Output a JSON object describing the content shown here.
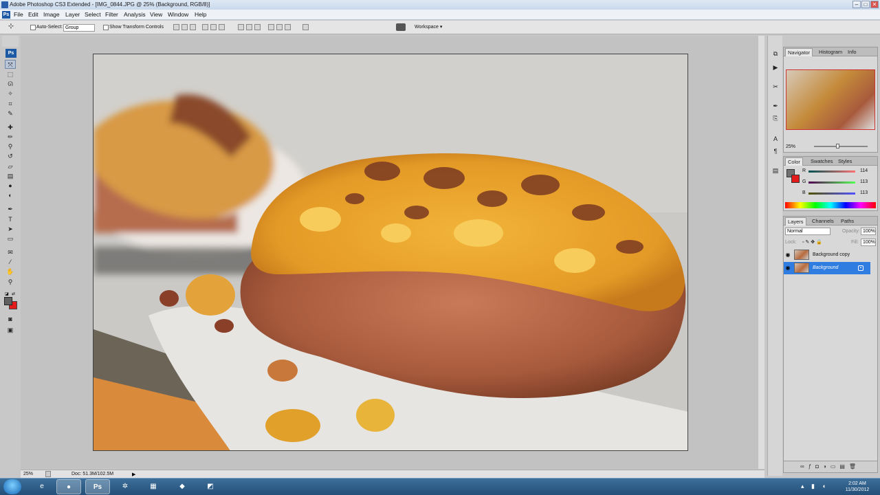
{
  "window": {
    "title": "Adobe Photoshop CS3 Extended - [IMG_0844.JPG @ 25% (Background, RGB/8)]",
    "controls": {
      "minimize": "–",
      "maximize": "□",
      "close": "✕"
    }
  },
  "menu": {
    "app_icon": "Ps",
    "items": [
      "File",
      "Edit",
      "Image",
      "Layer",
      "Select",
      "Filter",
      "Analysis",
      "View",
      "Window",
      "Help"
    ]
  },
  "options_bar": {
    "auto_select_label": "Auto-Select:",
    "auto_select_value": "Group",
    "transform_controls_label": "Show Transform Controls",
    "workspace_label": "Workspace ▾"
  },
  "tools": {
    "logo": "Ps",
    "icons": [
      "move-icon",
      "marquee-icon",
      "lasso-icon",
      "magic-wand-icon",
      "crop-icon",
      "slice-icon",
      "healing-brush-icon",
      "brush-icon",
      "clone-stamp-icon",
      "history-brush-icon",
      "eraser-icon",
      "gradient-icon",
      "blur-icon",
      "dodge-icon",
      "pen-icon",
      "type-icon",
      "path-selection-icon",
      "shape-icon",
      "notes-icon",
      "eyedropper-icon",
      "hand-icon",
      "zoom-icon"
    ],
    "foreground_color": "#606060",
    "background_color": "#e31b1b"
  },
  "status": {
    "zoom": "25%",
    "doc_size": "Doc: 51.3M/102.5M"
  },
  "navigator": {
    "tabs": [
      "Navigator",
      "Histogram",
      "Info"
    ],
    "zoom": "25%"
  },
  "color_panel": {
    "tabs": [
      "Color",
      "Swatches",
      "Styles"
    ],
    "channels": [
      {
        "label": "R",
        "value": "114"
      },
      {
        "label": "G",
        "value": "113"
      },
      {
        "label": "B",
        "value": "113"
      }
    ]
  },
  "layers_panel": {
    "tabs": [
      "Layers",
      "Channels",
      "Paths"
    ],
    "blend_mode": "Normal",
    "opacity_label": "Opacity:",
    "opacity_value": "100%",
    "lock_label": "Lock:",
    "fill_label": "Fill:",
    "fill_value": "100%",
    "layers": [
      {
        "name": "Background copy",
        "selected": false
      },
      {
        "name": "Background",
        "selected": true
      }
    ]
  },
  "taskbar": {
    "icons": [
      "ie-icon",
      "firefox-icon",
      "photoshop-icon",
      "network-icon",
      "notepad-icon",
      "app-icon",
      "paint-icon"
    ],
    "clock_time": "2:02 AM",
    "clock_date": "11/30/2012"
  },
  "colors": {
    "selection_blue": "#2f7de1",
    "ps_blue": "#1d5aa6"
  }
}
